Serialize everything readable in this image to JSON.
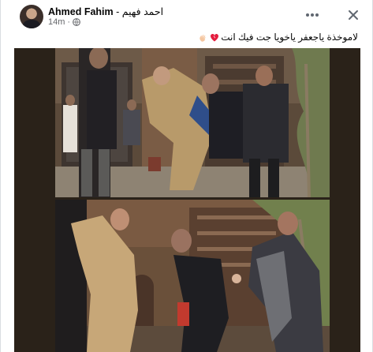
{
  "post": {
    "author": "Ahmed Fahim",
    "author_alt": "احمد فهيم",
    "separator": "-",
    "time": "14m",
    "caption": "لاموخذة ياجعفر ياخويا جت فيك انت"
  },
  "icons": {
    "more": "more-horizontal-icon",
    "close": "close-icon",
    "privacy": "globe-icon",
    "heart": "broken-heart-icon",
    "hand": "waving-hand-icon"
  },
  "colors": {
    "text": "#050505",
    "secondary_text": "#65676b",
    "photo_background": "#2a2219"
  }
}
